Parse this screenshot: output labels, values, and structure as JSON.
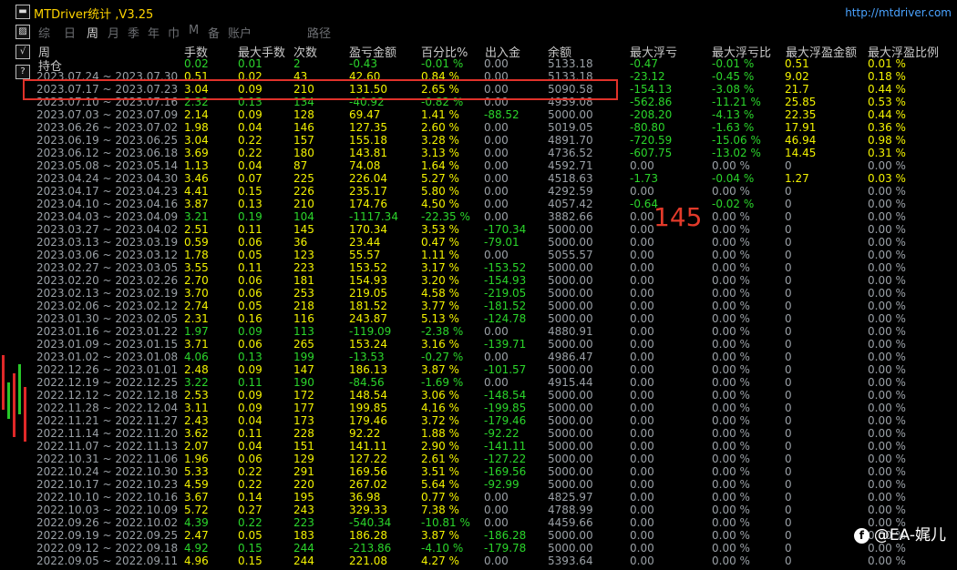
{
  "title": "MTDriver统计 ,V3.25",
  "url": "http://mtdriver.com",
  "tabs": [
    "综",
    "日",
    "周",
    "月",
    "季",
    "年",
    "巾",
    "M",
    "备",
    "账户",
    "路径"
  ],
  "active_tab": "周",
  "headers": [
    "周",
    "手数",
    "最大手数",
    "次数",
    "盈亏金额",
    "百分比%",
    "出入金",
    "余额",
    "最大浮亏",
    "最大浮亏比",
    "最大浮盈金额",
    "最大浮盈比例"
  ],
  "hold_label": "持仓",
  "annotation": "145",
  "watermark": "@EA-娓儿",
  "rows": [
    {
      "p": "",
      "lots": "0.02",
      "maxl": "0.01",
      "n": "2",
      "pl": "-0.43",
      "pct": "-0.01 %",
      "io": "0.00",
      "bal": "5133.18",
      "mfl": "-0.47",
      "mflp": "-0.01 %",
      "mfp": "0.51",
      "mfpp": "0.01 %"
    },
    {
      "p": "2023.07.24 ~ 2023.07.30",
      "lots": "0.51",
      "maxl": "0.02",
      "n": "43",
      "pl": "42.60",
      "pct": "0.84 %",
      "io": "0.00",
      "bal": "5133.18",
      "mfl": "-23.12",
      "mflp": "-0.45 %",
      "mfp": "9.02",
      "mfpp": "0.18 %"
    },
    {
      "p": "2023.07.17 ~ 2023.07.23",
      "lots": "3.04",
      "maxl": "0.09",
      "n": "210",
      "pl": "131.50",
      "pct": "2.65 %",
      "io": "0.00",
      "bal": "5090.58",
      "mfl": "-154.13",
      "mflp": "-3.08 %",
      "mfp": "21.7",
      "mfpp": "0.44 %"
    },
    {
      "p": "2023.07.10 ~ 2023.07.16",
      "lots": "2.32",
      "maxl": "0.13",
      "n": "134",
      "pl": "-40.92",
      "pct": "-0.82 %",
      "io": "0.00",
      "bal": "4959.08",
      "mfl": "-562.86",
      "mflp": "-11.21 %",
      "mfp": "25.85",
      "mfpp": "0.53 %"
    },
    {
      "p": "2023.07.03 ~ 2023.07.09",
      "lots": "2.14",
      "maxl": "0.09",
      "n": "128",
      "pl": "69.47",
      "pct": "1.41 %",
      "io": "-88.52",
      "bal": "5000.00",
      "mfl": "-208.20",
      "mflp": "-4.13 %",
      "mfp": "22.35",
      "mfpp": "0.44 %"
    },
    {
      "p": "2023.06.26 ~ 2023.07.02",
      "lots": "1.98",
      "maxl": "0.04",
      "n": "146",
      "pl": "127.35",
      "pct": "2.60 %",
      "io": "0.00",
      "bal": "5019.05",
      "mfl": "-80.80",
      "mflp": "-1.63 %",
      "mfp": "17.91",
      "mfpp": "0.36 %"
    },
    {
      "p": "2023.06.19 ~ 2023.06.25",
      "lots": "3.04",
      "maxl": "0.22",
      "n": "157",
      "pl": "155.18",
      "pct": "3.28 %",
      "io": "0.00",
      "bal": "4891.70",
      "mfl": "-720.59",
      "mflp": "-15.06 %",
      "mfp": "46.94",
      "mfpp": "0.98 %"
    },
    {
      "p": "2023.06.12 ~ 2023.06.18",
      "lots": "3.69",
      "maxl": "0.22",
      "n": "180",
      "pl": "143.81",
      "pct": "3.13 %",
      "io": "0.00",
      "bal": "4736.52",
      "mfl": "-607.75",
      "mflp": "-13.02 %",
      "mfp": "14.45",
      "mfpp": "0.31 %"
    },
    {
      "p": "2023.05.08 ~ 2023.05.14",
      "lots": "1.13",
      "maxl": "0.04",
      "n": "87",
      "pl": "74.08",
      "pct": "1.64 %",
      "io": "0.00",
      "bal": "4592.71",
      "mfl": "0.00",
      "mflp": "0.00 %",
      "mfp": "0",
      "mfpp": "0.00 %"
    },
    {
      "p": "2023.04.24 ~ 2023.04.30",
      "lots": "3.46",
      "maxl": "0.07",
      "n": "225",
      "pl": "226.04",
      "pct": "5.27 %",
      "io": "0.00",
      "bal": "4518.63",
      "mfl": "-1.73",
      "mflp": "-0.04 %",
      "mfp": "1.27",
      "mfpp": "0.03 %"
    },
    {
      "p": "2023.04.17 ~ 2023.04.23",
      "lots": "4.41",
      "maxl": "0.15",
      "n": "226",
      "pl": "235.17",
      "pct": "5.80 %",
      "io": "0.00",
      "bal": "4292.59",
      "mfl": "0.00",
      "mflp": "0.00 %",
      "mfp": "0",
      "mfpp": "0.00 %"
    },
    {
      "p": "2023.04.10 ~ 2023.04.16",
      "lots": "3.87",
      "maxl": "0.13",
      "n": "210",
      "pl": "174.76",
      "pct": "4.50 %",
      "io": "0.00",
      "bal": "4057.42",
      "mfl": "-0.64",
      "mflp": "-0.02 %",
      "mfp": "0",
      "mfpp": "0.00 %"
    },
    {
      "p": "2023.04.03 ~ 2023.04.09",
      "lots": "3.21",
      "maxl": "0.19",
      "n": "104",
      "pl": "-1117.34",
      "pct": "-22.35 %",
      "io": "0.00",
      "bal": "3882.66",
      "mfl": "0.00",
      "mflp": "0.00 %",
      "mfp": "0",
      "mfpp": "0.00 %"
    },
    {
      "p": "2023.03.27 ~ 2023.04.02",
      "lots": "2.51",
      "maxl": "0.11",
      "n": "145",
      "pl": "170.34",
      "pct": "3.53 %",
      "io": "-170.34",
      "bal": "5000.00",
      "mfl": "0.00",
      "mflp": "0.00 %",
      "mfp": "0",
      "mfpp": "0.00 %"
    },
    {
      "p": "2023.03.13 ~ 2023.03.19",
      "lots": "0.59",
      "maxl": "0.06",
      "n": "36",
      "pl": "23.44",
      "pct": "0.47 %",
      "io": "-79.01",
      "bal": "5000.00",
      "mfl": "0.00",
      "mflp": "0.00 %",
      "mfp": "0",
      "mfpp": "0.00 %"
    },
    {
      "p": "2023.03.06 ~ 2023.03.12",
      "lots": "1.78",
      "maxl": "0.05",
      "n": "123",
      "pl": "55.57",
      "pct": "1.11 %",
      "io": "0.00",
      "bal": "5055.57",
      "mfl": "0.00",
      "mflp": "0.00 %",
      "mfp": "0",
      "mfpp": "0.00 %"
    },
    {
      "p": "2023.02.27 ~ 2023.03.05",
      "lots": "3.55",
      "maxl": "0.11",
      "n": "223",
      "pl": "153.52",
      "pct": "3.17 %",
      "io": "-153.52",
      "bal": "5000.00",
      "mfl": "0.00",
      "mflp": "0.00 %",
      "mfp": "0",
      "mfpp": "0.00 %"
    },
    {
      "p": "2023.02.20 ~ 2023.02.26",
      "lots": "2.70",
      "maxl": "0.06",
      "n": "181",
      "pl": "154.93",
      "pct": "3.20 %",
      "io": "-154.93",
      "bal": "5000.00",
      "mfl": "0.00",
      "mflp": "0.00 %",
      "mfp": "0",
      "mfpp": "0.00 %"
    },
    {
      "p": "2023.02.13 ~ 2023.02.19",
      "lots": "3.70",
      "maxl": "0.06",
      "n": "253",
      "pl": "219.05",
      "pct": "4.58 %",
      "io": "-219.05",
      "bal": "5000.00",
      "mfl": "0.00",
      "mflp": "0.00 %",
      "mfp": "0",
      "mfpp": "0.00 %"
    },
    {
      "p": "2023.02.06 ~ 2023.02.12",
      "lots": "2.74",
      "maxl": "0.05",
      "n": "218",
      "pl": "181.52",
      "pct": "3.77 %",
      "io": "-181.52",
      "bal": "5000.00",
      "mfl": "0.00",
      "mflp": "0.00 %",
      "mfp": "0",
      "mfpp": "0.00 %"
    },
    {
      "p": "2023.01.30 ~ 2023.02.05",
      "lots": "2.31",
      "maxl": "0.16",
      "n": "116",
      "pl": "243.87",
      "pct": "5.13 %",
      "io": "-124.78",
      "bal": "5000.00",
      "mfl": "0.00",
      "mflp": "0.00 %",
      "mfp": "0",
      "mfpp": "0.00 %"
    },
    {
      "p": "2023.01.16 ~ 2023.01.22",
      "lots": "1.97",
      "maxl": "0.09",
      "n": "113",
      "pl": "-119.09",
      "pct": "-2.38 %",
      "io": "0.00",
      "bal": "4880.91",
      "mfl": "0.00",
      "mflp": "0.00 %",
      "mfp": "0",
      "mfpp": "0.00 %"
    },
    {
      "p": "2023.01.09 ~ 2023.01.15",
      "lots": "3.71",
      "maxl": "0.06",
      "n": "265",
      "pl": "153.24",
      "pct": "3.16 %",
      "io": "-139.71",
      "bal": "5000.00",
      "mfl": "0.00",
      "mflp": "0.00 %",
      "mfp": "0",
      "mfpp": "0.00 %"
    },
    {
      "p": "2023.01.02 ~ 2023.01.08",
      "lots": "4.06",
      "maxl": "0.13",
      "n": "199",
      "pl": "-13.53",
      "pct": "-0.27 %",
      "io": "0.00",
      "bal": "4986.47",
      "mfl": "0.00",
      "mflp": "0.00 %",
      "mfp": "0",
      "mfpp": "0.00 %"
    },
    {
      "p": "2022.12.26 ~ 2023.01.01",
      "lots": "2.48",
      "maxl": "0.09",
      "n": "147",
      "pl": "186.13",
      "pct": "3.87 %",
      "io": "-101.57",
      "bal": "5000.00",
      "mfl": "0.00",
      "mflp": "0.00 %",
      "mfp": "0",
      "mfpp": "0.00 %"
    },
    {
      "p": "2022.12.19 ~ 2022.12.25",
      "lots": "3.22",
      "maxl": "0.11",
      "n": "190",
      "pl": "-84.56",
      "pct": "-1.69 %",
      "io": "0.00",
      "bal": "4915.44",
      "mfl": "0.00",
      "mflp": "0.00 %",
      "mfp": "0",
      "mfpp": "0.00 %"
    },
    {
      "p": "2022.12.12 ~ 2022.12.18",
      "lots": "2.53",
      "maxl": "0.09",
      "n": "172",
      "pl": "148.54",
      "pct": "3.06 %",
      "io": "-148.54",
      "bal": "5000.00",
      "mfl": "0.00",
      "mflp": "0.00 %",
      "mfp": "0",
      "mfpp": "0.00 %"
    },
    {
      "p": "2022.11.28 ~ 2022.12.04",
      "lots": "3.11",
      "maxl": "0.09",
      "n": "177",
      "pl": "199.85",
      "pct": "4.16 %",
      "io": "-199.85",
      "bal": "5000.00",
      "mfl": "0.00",
      "mflp": "0.00 %",
      "mfp": "0",
      "mfpp": "0.00 %"
    },
    {
      "p": "2022.11.21 ~ 2022.11.27",
      "lots": "2.43",
      "maxl": "0.04",
      "n": "173",
      "pl": "179.46",
      "pct": "3.72 %",
      "io": "-179.46",
      "bal": "5000.00",
      "mfl": "0.00",
      "mflp": "0.00 %",
      "mfp": "0",
      "mfpp": "0.00 %"
    },
    {
      "p": "2022.11.14 ~ 2022.11.20",
      "lots": "3.62",
      "maxl": "0.11",
      "n": "228",
      "pl": "92.22",
      "pct": "1.88 %",
      "io": "-92.22",
      "bal": "5000.00",
      "mfl": "0.00",
      "mflp": "0.00 %",
      "mfp": "0",
      "mfpp": "0.00 %"
    },
    {
      "p": "2022.11.07 ~ 2022.11.13",
      "lots": "2.07",
      "maxl": "0.04",
      "n": "151",
      "pl": "141.11",
      "pct": "2.90 %",
      "io": "-141.11",
      "bal": "5000.00",
      "mfl": "0.00",
      "mflp": "0.00 %",
      "mfp": "0",
      "mfpp": "0.00 %"
    },
    {
      "p": "2022.10.31 ~ 2022.11.06",
      "lots": "1.96",
      "maxl": "0.06",
      "n": "129",
      "pl": "127.22",
      "pct": "2.61 %",
      "io": "-127.22",
      "bal": "5000.00",
      "mfl": "0.00",
      "mflp": "0.00 %",
      "mfp": "0",
      "mfpp": "0.00 %"
    },
    {
      "p": "2022.10.24 ~ 2022.10.30",
      "lots": "5.33",
      "maxl": "0.22",
      "n": "291",
      "pl": "169.56",
      "pct": "3.51 %",
      "io": "-169.56",
      "bal": "5000.00",
      "mfl": "0.00",
      "mflp": "0.00 %",
      "mfp": "0",
      "mfpp": "0.00 %"
    },
    {
      "p": "2022.10.17 ~ 2022.10.23",
      "lots": "4.59",
      "maxl": "0.22",
      "n": "220",
      "pl": "267.02",
      "pct": "5.64 %",
      "io": "-92.99",
      "bal": "5000.00",
      "mfl": "0.00",
      "mflp": "0.00 %",
      "mfp": "0",
      "mfpp": "0.00 %"
    },
    {
      "p": "2022.10.10 ~ 2022.10.16",
      "lots": "3.67",
      "maxl": "0.14",
      "n": "195",
      "pl": "36.98",
      "pct": "0.77 %",
      "io": "0.00",
      "bal": "4825.97",
      "mfl": "0.00",
      "mflp": "0.00 %",
      "mfp": "0",
      "mfpp": "0.00 %"
    },
    {
      "p": "2022.10.03 ~ 2022.10.09",
      "lots": "5.72",
      "maxl": "0.27",
      "n": "243",
      "pl": "329.33",
      "pct": "7.38 %",
      "io": "0.00",
      "bal": "4788.99",
      "mfl": "0.00",
      "mflp": "0.00 %",
      "mfp": "0",
      "mfpp": "0.00 %"
    },
    {
      "p": "2022.09.26 ~ 2022.10.02",
      "lots": "4.39",
      "maxl": "0.22",
      "n": "223",
      "pl": "-540.34",
      "pct": "-10.81 %",
      "io": "0.00",
      "bal": "4459.66",
      "mfl": "0.00",
      "mflp": "0.00 %",
      "mfp": "0",
      "mfpp": "0.00 %"
    },
    {
      "p": "2022.09.19 ~ 2022.09.25",
      "lots": "2.47",
      "maxl": "0.05",
      "n": "183",
      "pl": "186.28",
      "pct": "3.87 %",
      "io": "-186.28",
      "bal": "5000.00",
      "mfl": "0.00",
      "mflp": "0.00 %",
      "mfp": "0",
      "mfpp": "0.00 %"
    },
    {
      "p": "2022.09.12 ~ 2022.09.18",
      "lots": "4.92",
      "maxl": "0.15",
      "n": "244",
      "pl": "-213.86",
      "pct": "-4.10 %",
      "io": "-179.78",
      "bal": "5000.00",
      "mfl": "0.00",
      "mflp": "0.00 %",
      "mfp": "0",
      "mfpp": "0.00 %"
    },
    {
      "p": "2022.09.05 ~ 2022.09.11",
      "lots": "4.96",
      "maxl": "0.15",
      "n": "244",
      "pl": "221.08",
      "pct": "4.27 %",
      "io": "0.00",
      "bal": "5393.64",
      "mfl": "0.00",
      "mflp": "0.00 %",
      "mfp": "0",
      "mfpp": "0.00 %"
    }
  ],
  "colors": {
    "positive": "#f2f200",
    "negative": "#2bd52b",
    "neutral": "#9aa0a6",
    "highlight": "#e0322a",
    "title": "#ffd400",
    "url": "#4aa3ff"
  }
}
